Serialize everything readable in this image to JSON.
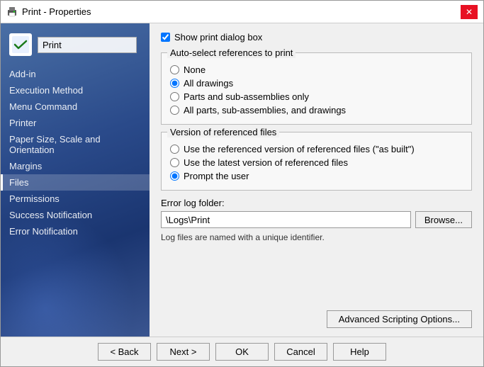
{
  "window": {
    "title": "Print - Properties",
    "close_label": "✕"
  },
  "sidebar": {
    "logo_alt": "print-icon",
    "title_value": "Print",
    "items": [
      {
        "id": "add-in",
        "label": "Add-in",
        "active": false,
        "selected": false
      },
      {
        "id": "execution-method",
        "label": "Execution Method",
        "active": false,
        "selected": false
      },
      {
        "id": "menu-command",
        "label": "Menu Command",
        "active": false,
        "selected": false
      },
      {
        "id": "printer",
        "label": "Printer",
        "active": false,
        "selected": false
      },
      {
        "id": "paper-size",
        "label": "Paper Size, Scale and Orientation",
        "active": false,
        "selected": false
      },
      {
        "id": "margins",
        "label": "Margins",
        "active": false,
        "selected": false
      },
      {
        "id": "files",
        "label": "Files",
        "active": true,
        "selected": true
      },
      {
        "id": "permissions",
        "label": "Permissions",
        "active": false,
        "selected": false
      },
      {
        "id": "success-notification",
        "label": "Success Notification",
        "active": false,
        "selected": false
      },
      {
        "id": "error-notification",
        "label": "Error Notification",
        "active": false,
        "selected": false
      }
    ]
  },
  "main": {
    "show_print_dialog": {
      "label": "Show print dialog box",
      "checked": true
    },
    "auto_select_section": {
      "label": "Auto-select references to print",
      "options": [
        {
          "id": "none",
          "label": "None",
          "checked": false
        },
        {
          "id": "all-drawings",
          "label": "All drawings",
          "checked": true
        },
        {
          "id": "parts-sub",
          "label": "Parts and sub-assemblies only",
          "checked": false
        },
        {
          "id": "all-parts",
          "label": "All parts, sub-assemblies, and drawings",
          "checked": false
        }
      ]
    },
    "version_section": {
      "label": "Version of referenced files",
      "options": [
        {
          "id": "as-built",
          "label": "Use the referenced version of referenced files (\"as built\")",
          "checked": false
        },
        {
          "id": "latest",
          "label": "Use the latest version of referenced files",
          "checked": false
        },
        {
          "id": "prompt",
          "label": "Prompt the user",
          "checked": true
        }
      ]
    },
    "error_log": {
      "label": "Error log folder:",
      "value": "\\Logs\\Print",
      "browse_label": "Browse...",
      "info_text": "Log files are named with a unique identifier."
    },
    "advanced_btn": "Advanced Scripting Options...",
    "buttons": {
      "back": "< Back",
      "next": "Next >",
      "ok": "OK",
      "cancel": "Cancel",
      "help": "Help"
    }
  }
}
